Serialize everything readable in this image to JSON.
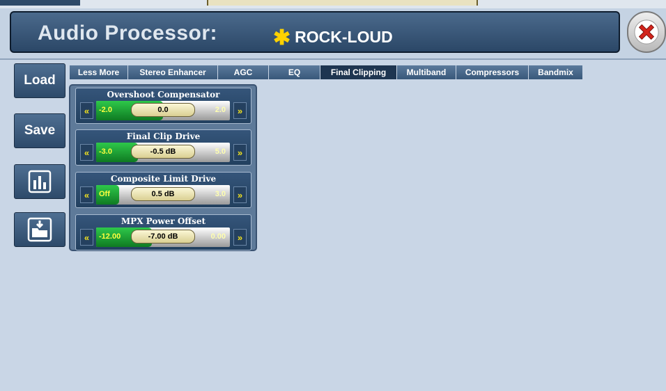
{
  "header": {
    "title": "Audio Processor:",
    "preset_name": "ROCK-LOUD",
    "preset_marker": "✱"
  },
  "sidebar": {
    "load_label": "Load",
    "save_label": "Save"
  },
  "tabs": [
    {
      "label": "Less More",
      "active": false
    },
    {
      "label": "Stereo Enhancer",
      "active": false
    },
    {
      "label": "AGC",
      "active": false
    },
    {
      "label": "EQ",
      "active": false
    },
    {
      "label": "Final Clipping",
      "active": true
    },
    {
      "label": "Multiband",
      "active": false
    },
    {
      "label": "Compressors",
      "active": false
    },
    {
      "label": "Bandmix",
      "active": false
    }
  ],
  "controls": [
    {
      "label": "Overshoot Compensator",
      "min": "-2.0",
      "max": "2.0",
      "value": "0.0",
      "level_fraction": 0.5
    },
    {
      "label": "Final Clip Drive",
      "min": "-3.0",
      "max": "5.0",
      "value": "-0.5 dB",
      "level_fraction": 0.3125
    },
    {
      "label": "Composite Limit Drive",
      "min": "Off",
      "max": "3.0",
      "value": "0.5 dB",
      "level_fraction": 0.17
    },
    {
      "label": "MPX Power Offset",
      "min": "-12.00",
      "max": "0.00",
      "value": "-7.00 dB",
      "level_fraction": 0.4167
    }
  ],
  "arrows": {
    "left": "«",
    "right": "»"
  },
  "colors": {
    "accent_yellow": "#ffd200",
    "slider_green": "#1fa336",
    "active_tab": "#1e3550"
  },
  "icons": {
    "close": "close-x-icon",
    "meter": "bar-chart-icon",
    "load_file": "folder-download-icon"
  }
}
